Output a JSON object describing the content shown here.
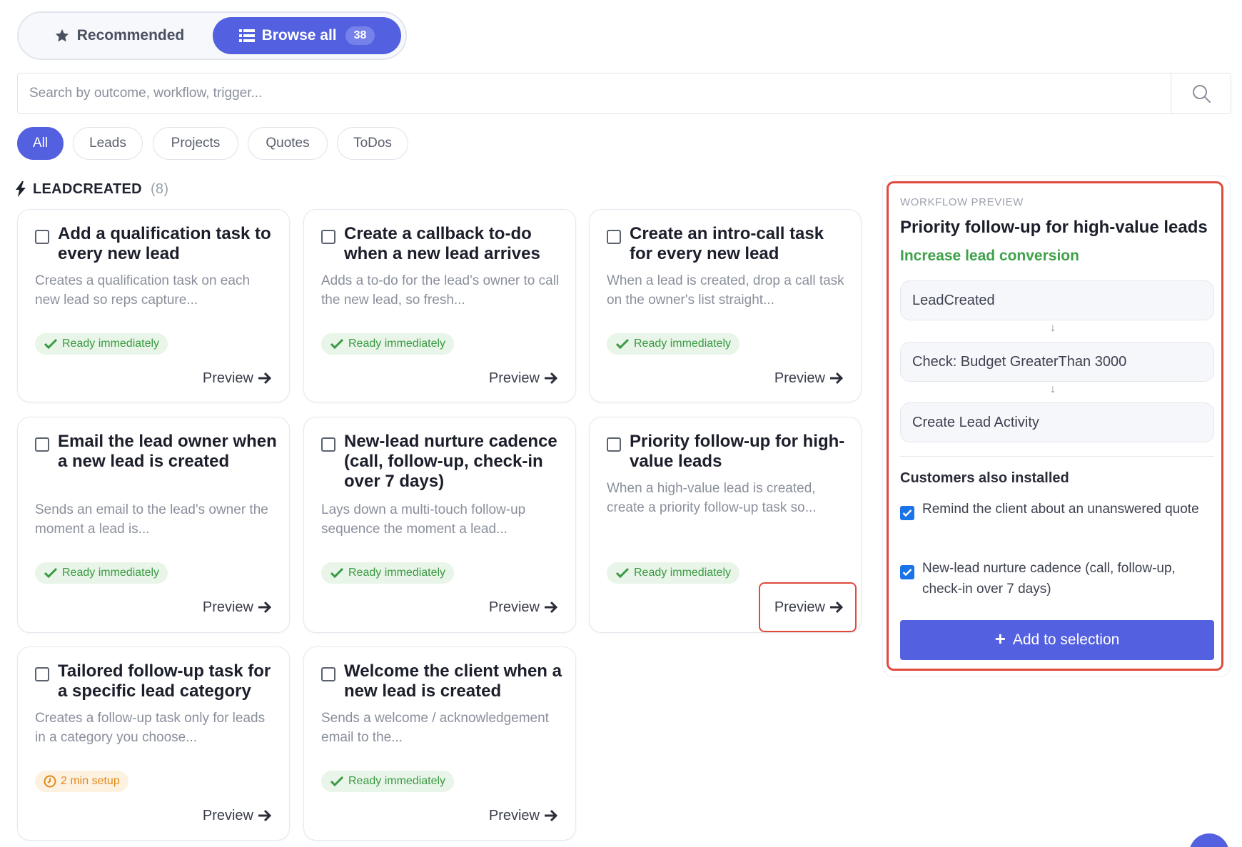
{
  "toggle": {
    "recommended_label": "Recommended",
    "browse_all_label": "Browse all",
    "browse_all_count": "38"
  },
  "search": {
    "placeholder": "Search by outcome, workflow, trigger..."
  },
  "filters": [
    "All",
    "Leads",
    "Projects",
    "Quotes",
    "ToDos"
  ],
  "section": {
    "title": "LEADCREATED",
    "count": "(8)"
  },
  "cards": [
    {
      "title": "Add a qualification task to every new lead",
      "desc": "Creates a qualification task on each new lead so reps capture...",
      "badge": "Ready immediately",
      "preview": "Preview"
    },
    {
      "title": "Create a callback to-do when a new lead arrives",
      "desc": "Adds a to-do for the lead's owner to call the new lead, so fresh...",
      "badge": "Ready immediately",
      "preview": "Preview"
    },
    {
      "title": "Create an intro-call task for every new lead",
      "desc": "When a lead is created, drop a call task on the owner's list straight...",
      "badge": "Ready immediately",
      "preview": "Preview"
    },
    {
      "title": "Email the lead owner when a new lead is created",
      "desc": "Sends an email to the lead's owner the moment a lead is...",
      "badge": "Ready immediately",
      "preview": "Preview"
    },
    {
      "title": "New-lead nurture cadence (call, follow-up, check-in over 7 days)",
      "desc": "Lays down a multi-touch follow-up sequence the moment a lead...",
      "badge": "Ready immediately",
      "preview": "Preview"
    },
    {
      "title": "Priority follow-up for high-value leads",
      "desc": "When a high-value lead is created, create a priority follow-up task so...",
      "badge": "Ready immediately",
      "preview": "Preview"
    },
    {
      "title": "Tailored follow-up task for a specific lead category",
      "desc": "Creates a follow-up task only for leads in a category you choose...",
      "badge": "2 min setup",
      "preview": "Preview"
    },
    {
      "title": "Welcome the client when a new lead is created",
      "desc": "Sends a welcome / acknowledgement email to the...",
      "badge": "Ready immediately",
      "preview": "Preview"
    }
  ],
  "panel": {
    "eyebrow": "WORKFLOW PREVIEW",
    "title": "Priority follow-up for high-value leads",
    "subtitle": "Increase lead conversion",
    "steps": [
      "LeadCreated",
      "Check: Budget GreaterThan 3000",
      "Create Lead Activity"
    ],
    "arrow": "↓",
    "also_title": "Customers also installed",
    "also_items": [
      "Remind the client about an unanswered quote",
      "New-lead nurture cadence (call, follow-up, check-in over 7 days)"
    ],
    "add_label": "Add to selection",
    "add_icon": "+"
  },
  "colors": {
    "accent": "#5360df",
    "ready_green": "#3a9a43",
    "setup_orange": "#e08a1c",
    "highlight_red": "#e04a3c",
    "subtitle_green": "#3fa14a"
  },
  "icons": {
    "recommended": "star-icon",
    "browse_all": "list-icon",
    "search": "search-icon",
    "section": "bolt-icon",
    "ready": "check-icon",
    "setup": "clock-icon",
    "preview": "arrow-right-icon",
    "add": "plus-icon"
  }
}
